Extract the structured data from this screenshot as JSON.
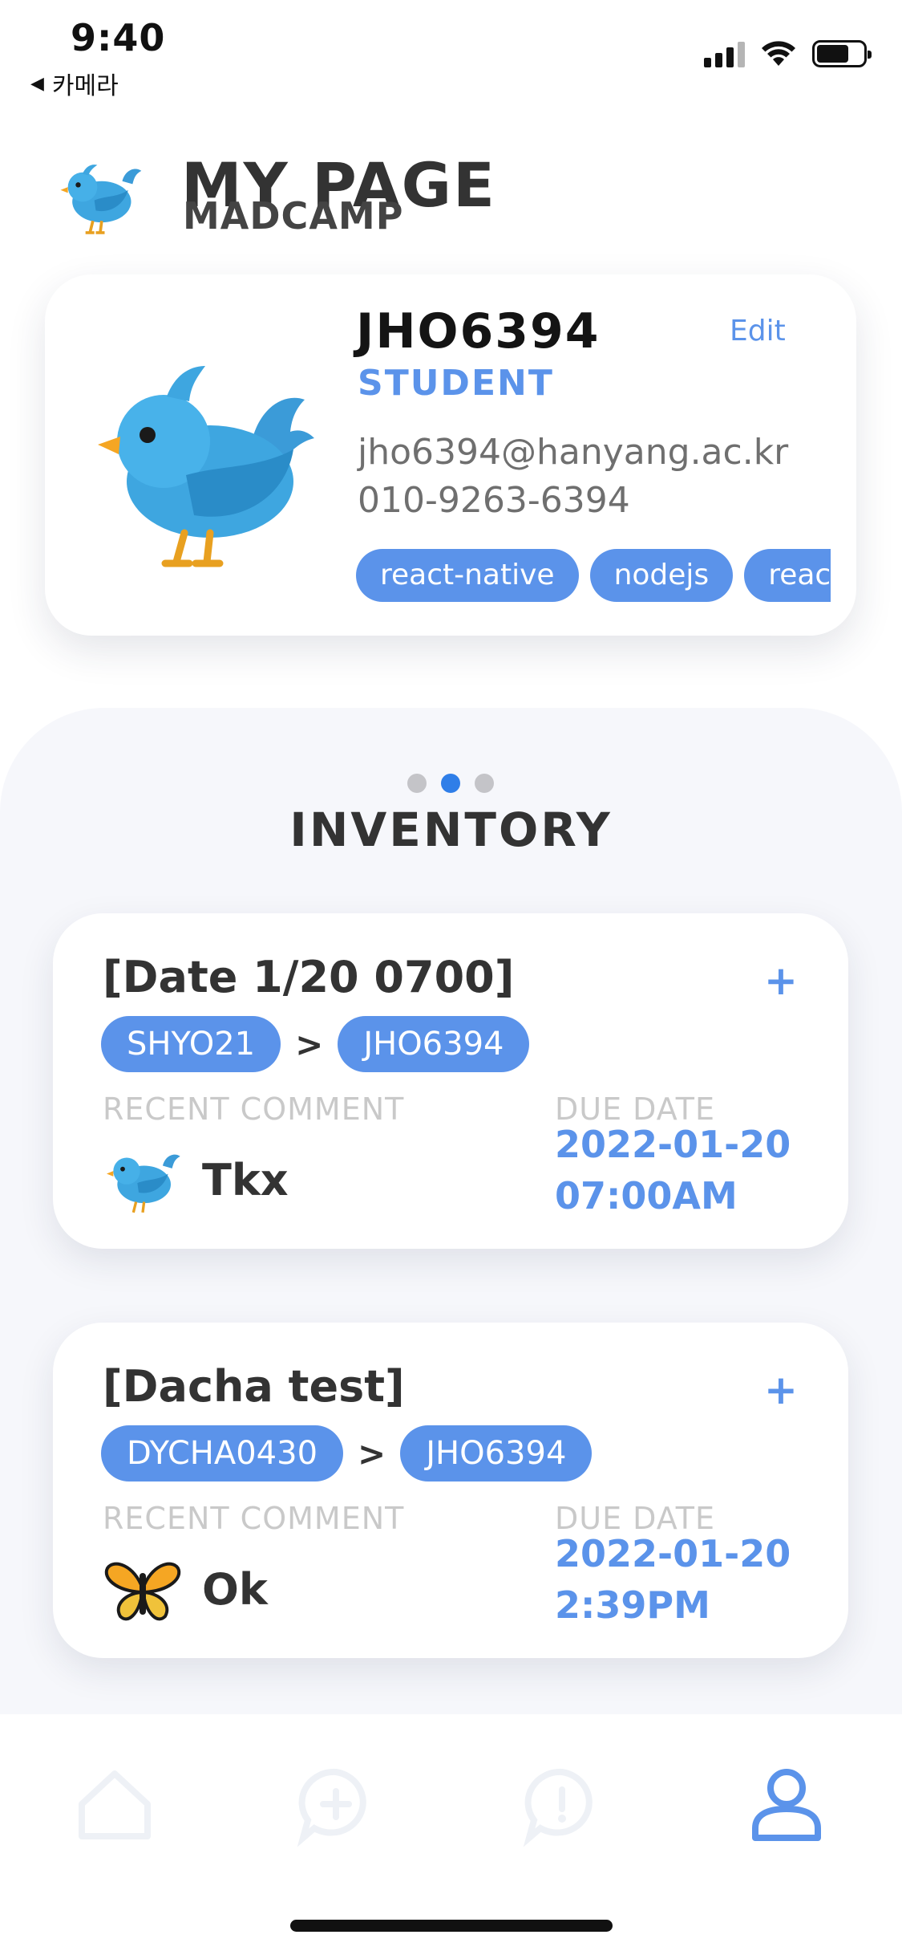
{
  "status_bar": {
    "time": "9:40",
    "back_app": "카메라",
    "battery_level": 0.7
  },
  "header": {
    "title": "MY PAGE",
    "subtitle": "MADCAMP",
    "logo_icon": "bluebird-icon"
  },
  "profile": {
    "name": "JHO6394",
    "role": "STUDENT",
    "email": "jho6394@hanyang.ac.kr",
    "phone": "010-9263-6394",
    "edit_label": "Edit",
    "avatar_icon": "bluebird-icon",
    "tags": [
      "react-native",
      "nodejs",
      "react"
    ]
  },
  "inventory": {
    "title": "INVENTORY",
    "page_dots": {
      "count": 3,
      "active_index": 1
    },
    "recent_comment_label": "RECENT COMMENT",
    "due_date_label": "DUE DATE",
    "add_icon": "plus-icon",
    "cards": [
      {
        "title": "[Date 1/20 0700]",
        "from": "SHYO21",
        "arrow": ">",
        "to": "JHO6394",
        "comment_avatar": "bluebird-icon",
        "comment": "Tkx",
        "due_date": "2022-01-20",
        "due_time": "07:00AM"
      },
      {
        "title": "[Dacha test]",
        "from": "DYCHA0430",
        "arrow": ">",
        "to": "JHO6394",
        "comment_avatar": "butterfly-icon",
        "comment": "Ok",
        "due_date": "2022-01-20",
        "due_time": "2:39PM"
      }
    ]
  },
  "tab_bar": {
    "active_index": 3,
    "tabs": [
      {
        "icon": "home-icon"
      },
      {
        "icon": "chat-add-icon"
      },
      {
        "icon": "chat-alert-icon"
      },
      {
        "icon": "profile-icon"
      }
    ],
    "active_color": "#5b93ea",
    "inactive_color": "#eef1f6"
  },
  "colors": {
    "accent": "#5b93ea",
    "active_dot": "#2f7ee8",
    "text_dark": "#333333",
    "label_gray": "#c9c9c9"
  }
}
